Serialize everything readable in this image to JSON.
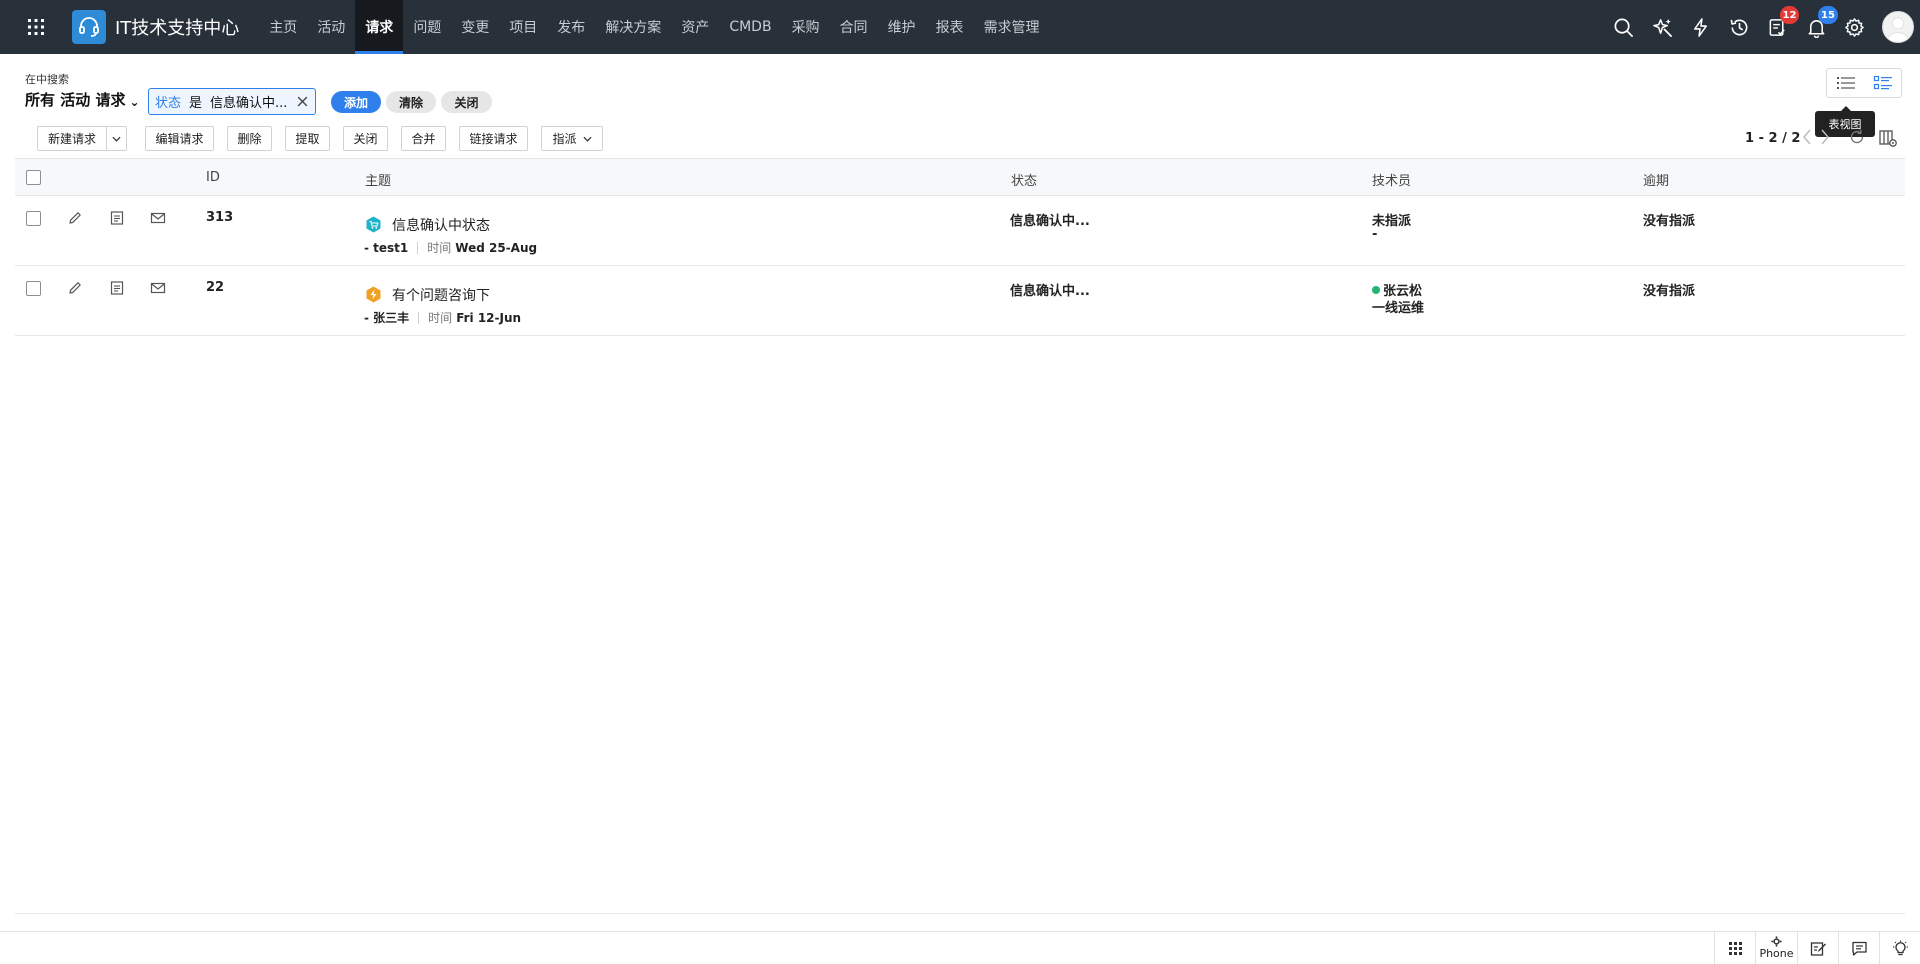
{
  "app": {
    "title": "IT技术支持中心"
  },
  "nav": {
    "tabs": [
      {
        "label": "主页"
      },
      {
        "label": "活动"
      },
      {
        "label": "请求",
        "active": true
      },
      {
        "label": "问题"
      },
      {
        "label": "变更"
      },
      {
        "label": "项目"
      },
      {
        "label": "发布"
      },
      {
        "label": "解决方案"
      },
      {
        "label": "资产"
      },
      {
        "label": "CMDB"
      },
      {
        "label": "采购"
      },
      {
        "label": "合同"
      },
      {
        "label": "维护"
      },
      {
        "label": "报表"
      },
      {
        "label": "需求管理"
      }
    ]
  },
  "header_icons": {
    "tasks_badge": "12",
    "notifications_badge": "15",
    "icons": [
      "search-icon",
      "magic-wand-icon",
      "lightning-icon",
      "history-icon",
      "tasks-icon",
      "bell-icon",
      "gear-icon"
    ]
  },
  "filter": {
    "search_scope": "在中搜索",
    "view_name": "所有 活动 请求",
    "chip_field": "状态",
    "chip_op": "是",
    "chip_value": "信息确认中...",
    "add_label": "添加",
    "clear_label": "清除",
    "close_label": "关闭"
  },
  "view_toggle": {
    "tooltip": "表视图"
  },
  "toolbar": {
    "new_request": "新建请求",
    "edit_request": "编辑请求",
    "delete": "删除",
    "pickup": "提取",
    "close": "关闭",
    "merge": "合并",
    "link_request": "链接请求",
    "assign": "指派",
    "pager": "1 - 2 / 2"
  },
  "table": {
    "columns": {
      "id": "ID",
      "subject": "主题",
      "status": "状态",
      "technician": "技术员",
      "due": "逾期"
    },
    "rows": [
      {
        "id": "313",
        "subject": "信息确认中状态",
        "requester": "- test1",
        "time_label": "时间",
        "time": "Wed 25-Aug",
        "status": "信息确认中...",
        "technician": "未指派",
        "group": "-",
        "due": "没有指派",
        "icon": "shopping-cart-icon",
        "icon_color": "#20b2c7"
      },
      {
        "id": "22",
        "subject": "有个问题咨询下",
        "requester": "- 张三丰",
        "time_label": "时间",
        "time": "Fri 12-Jun",
        "status": "信息确认中...",
        "technician": "张云松",
        "group": "一线运维",
        "due": "没有指派",
        "icon": "incident-icon",
        "icon_color": "#f0a024"
      }
    ]
  },
  "footer": {
    "phone_label": "Phone"
  },
  "colors": {
    "navbar": "#283039",
    "accent": "#2f80ed",
    "online": "#22b573",
    "badge_red": "#e53935"
  }
}
